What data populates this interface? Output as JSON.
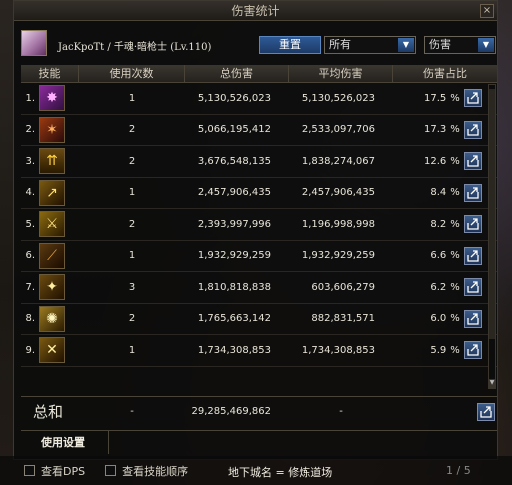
{
  "window": {
    "title": "伤害统计",
    "close": "×"
  },
  "header": {
    "char_name": "JacKpoTt / 千魂·暗枪士 (Lv.110)",
    "reset_label": "重置",
    "filter1": "所有",
    "filter2": "伤害"
  },
  "table": {
    "headers": [
      "技能",
      "使用次数",
      "总伤害",
      "平均伤害",
      "伤害占比"
    ],
    "rows": [
      {
        "idx": "1.",
        "icon": "purple-flame-skill-icon",
        "uses": "1",
        "total": "5,130,526,023",
        "avg": "5,130,526,023",
        "pct": "17.5",
        "unit": "%"
      },
      {
        "idx": "2.",
        "icon": "spear-rain-skill-icon",
        "uses": "2",
        "total": "5,066,195,412",
        "avg": "2,533,097,706",
        "pct": "17.3",
        "unit": "%"
      },
      {
        "idx": "3.",
        "icon": "golden-spikes-skill-icon",
        "uses": "2",
        "total": "3,676,548,135",
        "avg": "1,838,274,067",
        "pct": "12.6",
        "unit": "%"
      },
      {
        "idx": "4.",
        "icon": "spear-thrust-skill-icon",
        "uses": "1",
        "total": "2,457,906,435",
        "avg": "2,457,906,435",
        "pct": "8.4",
        "unit": "%"
      },
      {
        "idx": "5.",
        "icon": "twin-blade-skill-icon",
        "uses": "2",
        "total": "2,393,997,996",
        "avg": "1,196,998,998",
        "pct": "8.2",
        "unit": "%"
      },
      {
        "idx": "6.",
        "icon": "dark-lance-skill-icon",
        "uses": "1",
        "total": "1,932,929,259",
        "avg": "1,932,929,259",
        "pct": "6.6",
        "unit": "%"
      },
      {
        "idx": "7.",
        "icon": "star-burst-skill-icon",
        "uses": "3",
        "total": "1,810,818,838",
        "avg": "603,606,279",
        "pct": "6.2",
        "unit": "%"
      },
      {
        "idx": "8.",
        "icon": "radiant-flash-skill-icon",
        "uses": "2",
        "total": "1,765,663,142",
        "avg": "882,831,571",
        "pct": "6.0",
        "unit": "%"
      },
      {
        "idx": "9.",
        "icon": "cross-slash-skill-icon",
        "uses": "1",
        "total": "1,734,308,853",
        "avg": "1,734,308,853",
        "pct": "5.9",
        "unit": "%"
      }
    ]
  },
  "total": {
    "label": "总和",
    "uses": "-",
    "total": "29,285,469,862",
    "avg": "-"
  },
  "settings": {
    "label": "使用设置"
  },
  "bottom": {
    "check_dps": "查看DPS",
    "check_order": "查看技能顺序",
    "dungeon": "地下城名 = 修炼道场",
    "page": "1 / 5"
  },
  "colors": {
    "accent_blue": "#2e5a96",
    "panel_bg": "#0c0c0c"
  }
}
